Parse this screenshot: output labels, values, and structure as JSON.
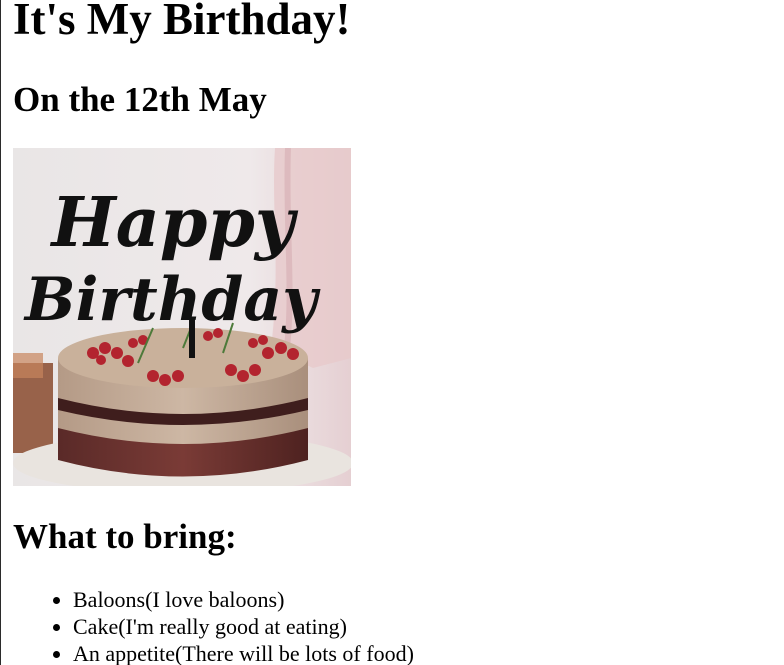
{
  "page": {
    "title": "It's My Birthday!",
    "subtitle": "On the 12th May"
  },
  "image": {
    "topper_line_1": "Happy",
    "topper_line_2": "Birthday"
  },
  "bring": {
    "heading": "What to bring:",
    "items": [
      {
        "label": "Baloons(I love baloons)"
      },
      {
        "label": "Cake(I'm really good at eating)"
      },
      {
        "label": "An appetite(There will be lots of food)"
      }
    ]
  }
}
